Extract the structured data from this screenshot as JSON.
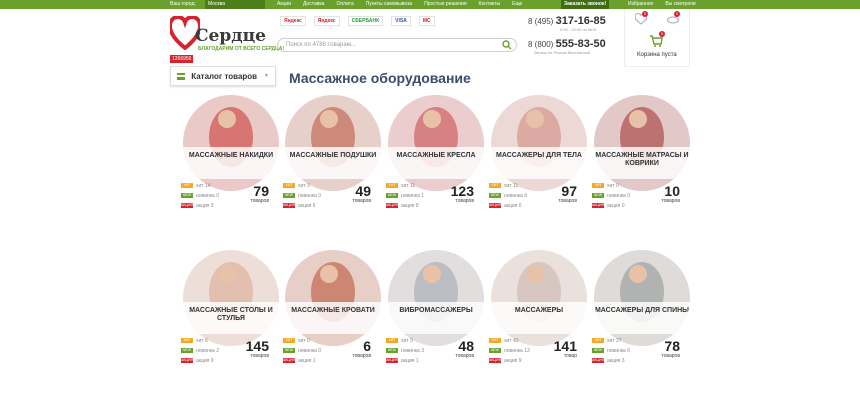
{
  "topbar": {
    "city_label": "Ваш город:",
    "city_value": "Москва",
    "nav": [
      "Акции",
      "Доставка",
      "Оплата",
      "Пункты самовывоза",
      "Простые решения",
      "Контакты",
      "Еще"
    ],
    "callback_label": "Заказать звонок!",
    "right_links": [
      "Избранное",
      "Вы смотрели"
    ]
  },
  "logo": {
    "name": "Сердце",
    "tagline": "БЛАГОДАРИМ ОТ ВСЕГО СЕРДЦА!",
    "counter": "1266956"
  },
  "payments": [
    "Яндекс",
    "Яндекс",
    "СБЕРБАНК",
    "VISA",
    "MC"
  ],
  "search": {
    "placeholder": "Поиск по 4788 товарам..."
  },
  "phones": {
    "phone1_prefix": "8 (495)",
    "phone1_number": "317-16-85",
    "hours": "9:00 - 22:00 по МСК",
    "phone2_prefix": "8 (800)",
    "phone2_number": "555-83-50",
    "note": "Звонок по России бесплатный"
  },
  "header_icons": {
    "favorites_count": "0",
    "compare_count": "0",
    "cart_count": "0",
    "cart_label": "Корзина пуста"
  },
  "catalog": {
    "label": "Каталог товаров"
  },
  "page_title": "Массажное оборудование",
  "labels": {
    "hit": "хит",
    "new": "новинка",
    "sale": "акция"
  },
  "tags": {
    "hit": "ХИТ",
    "new": "NEW",
    "sale": "АКЦИЯ"
  },
  "categories": [
    {
      "name": "Массажные накидки",
      "hit": "14",
      "new": "0",
      "sale": "3",
      "count": "79",
      "unit": "товаров",
      "color": "#c9302c"
    },
    {
      "name": "Массажные подушки",
      "hit": "3",
      "new": "0",
      "sale": "6",
      "count": "49",
      "unit": "товаров",
      "color": "#b8513b"
    },
    {
      "name": "Массажные кресла",
      "hit": "11",
      "new": "1",
      "sale": "9",
      "count": "123",
      "unit": "товаров",
      "color": "#c7444a"
    },
    {
      "name": "Массажеры для тела",
      "hit": "11",
      "new": "9",
      "sale": "0",
      "count": "97",
      "unit": "товаров",
      "color": "#d0837a"
    },
    {
      "name": "Массажные матрасы и коврики",
      "hit": "0",
      "new": "0",
      "sale": "0",
      "count": "10",
      "unit": "товаров",
      "color": "#9c2a2a"
    },
    {
      "name": "Массажные столы и стулья",
      "hit": "6",
      "new": "2",
      "sale": "0",
      "count": "145",
      "unit": "товаров",
      "color": "#d8a48c"
    },
    {
      "name": "Массажные кровати",
      "hit": "0",
      "new": "0",
      "sale": "1",
      "count": "6",
      "unit": "товаров",
      "color": "#b84a2a"
    },
    {
      "name": "Вибромассажеры",
      "hit": "9",
      "new": "3",
      "sale": "1",
      "count": "48",
      "unit": "товаров",
      "color": "#9aa2ad"
    },
    {
      "name": "Массажеры",
      "hit": "43",
      "new": "13",
      "sale": "9",
      "count": "141",
      "unit": "товар",
      "color": "#c9b3a8"
    },
    {
      "name": "Массажеры для спины",
      "hit": "27",
      "new": "6",
      "sale": "3",
      "count": "78",
      "unit": "товаров",
      "color": "#8a8f92"
    }
  ]
}
